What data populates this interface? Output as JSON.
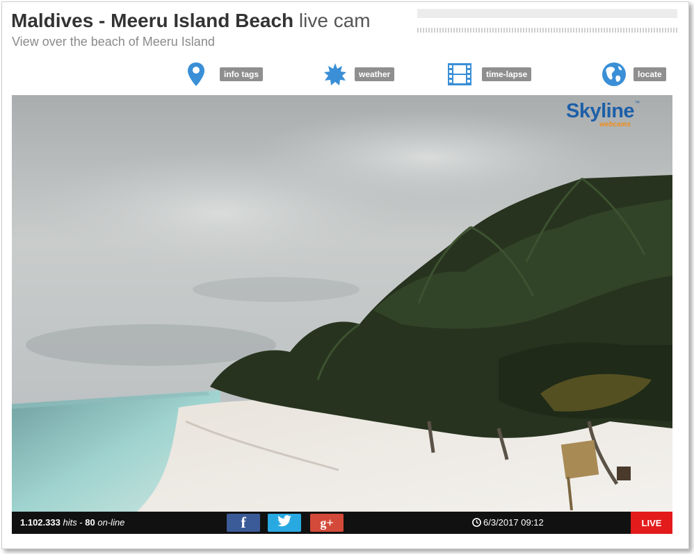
{
  "header": {
    "title_main": "Maldives - Meeru Island Beach",
    "title_suffix": "live cam",
    "subtitle": "View over the beach of Meeru Island"
  },
  "toolbar": {
    "items": [
      {
        "label": "info tags",
        "icon": "map-pin-icon"
      },
      {
        "label": "weather",
        "icon": "sun-icon"
      },
      {
        "label": "time-lapse",
        "icon": "film-strip-icon"
      },
      {
        "label": "locate",
        "icon": "globe-icon"
      }
    ],
    "icon_color": "#3a8fd6"
  },
  "logo": {
    "name": "Skyline",
    "tagline": "webcams",
    "trademark": "™"
  },
  "status": {
    "hits": "1.102.333",
    "hits_label": "hits",
    "separator": "-",
    "online": "80",
    "online_label": "on-line",
    "datetime": "6/3/2017 09:12",
    "live_label": "LIVE"
  },
  "social": {
    "facebook": "f",
    "googleplus": "g+"
  },
  "colors": {
    "facebook": "#3b5b98",
    "twitter": "#29a9e1",
    "googleplus": "#d44a3a",
    "live": "#e31b1b"
  }
}
